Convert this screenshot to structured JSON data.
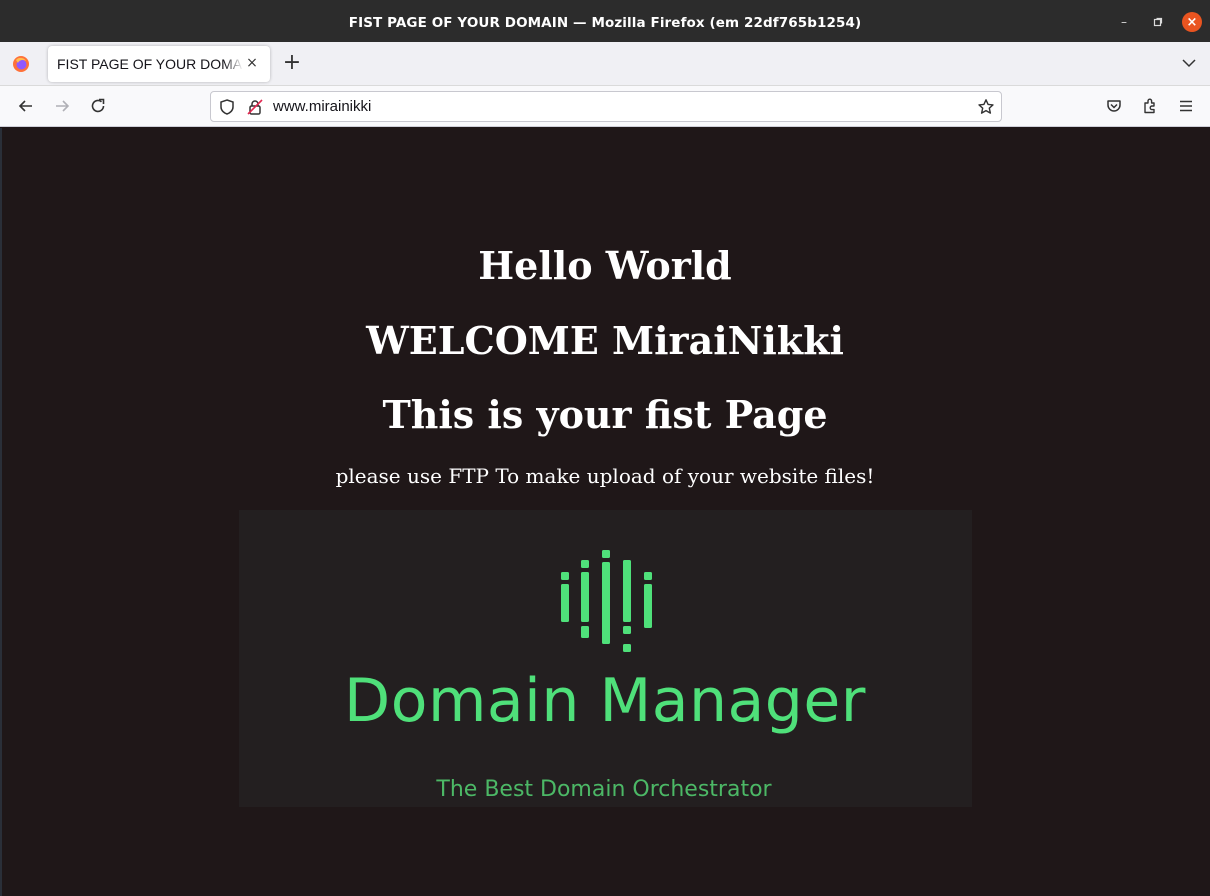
{
  "window": {
    "title": "FIST PAGE OF YOUR DOMAIN — Mozilla Firefox (em 22df765b1254)"
  },
  "tabs": [
    {
      "label": "FIST PAGE OF YOUR DOMAIN"
    }
  ],
  "urlbar": {
    "url": "www.mirainikki"
  },
  "page": {
    "headings": [
      "Hello World",
      "WELCOME MiraiNikki",
      "This is your fist Page"
    ],
    "subtext": "please use FTP To make upload of your website files!",
    "banner": {
      "brand": "Domain Manager",
      "tagline": "The Best Domain Orchestrator",
      "accent_color": "#4fe07a"
    }
  },
  "icons": {
    "window": [
      "minimize-icon",
      "maximize-icon",
      "close-icon"
    ],
    "nav": [
      "back-icon",
      "forward-icon",
      "reload-icon",
      "shield-icon",
      "insecure-lock-icon",
      "bookmark-star-icon",
      "pocket-icon",
      "extensions-icon",
      "menu-icon"
    ]
  }
}
